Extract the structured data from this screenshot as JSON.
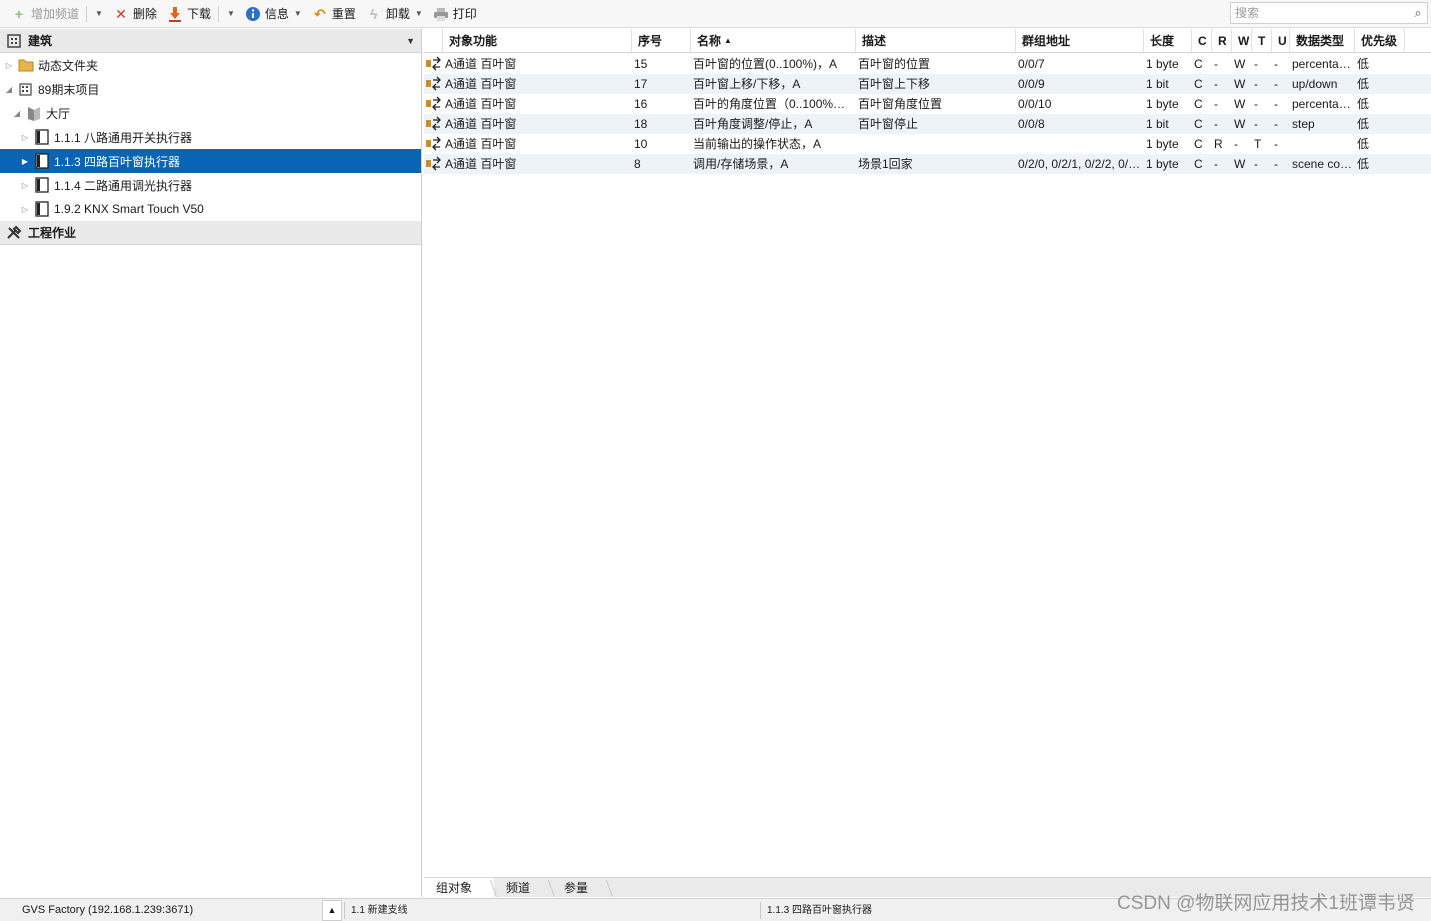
{
  "toolbar": {
    "add_channel": "增加频道",
    "delete": "删除",
    "download": "下载",
    "info": "信息",
    "reset": "重置",
    "unload": "卸载",
    "print": "打印",
    "search_placeholder": "搜索"
  },
  "left_panel": {
    "header": "建筑",
    "tree": [
      {
        "label": "动态文件夹",
        "icon": "folder-icon"
      },
      {
        "label": "89期末项目",
        "icon": "building-icon"
      },
      {
        "label": "大厅",
        "icon": "room-icon"
      },
      {
        "label": "1.1.1 八路通用开关执行器",
        "icon": "device-icon"
      },
      {
        "label": "1.1.3 四路百叶窗执行器",
        "icon": "device-icon",
        "selected": true
      },
      {
        "label": "1.1.4 二路通用调光执行器",
        "icon": "device-icon"
      },
      {
        "label": "1.9.2 KNX Smart Touch V50",
        "icon": "device-icon"
      }
    ],
    "work_header": "工程作业"
  },
  "grid": {
    "columns": [
      "对象功能",
      "序号",
      "名称",
      "描述",
      "群组地址",
      "长度",
      "C",
      "R",
      "W",
      "T",
      "U",
      "数据类型",
      "优先级"
    ],
    "rows": [
      [
        "A通道 百叶窗",
        "15",
        "百叶窗的位置(0..100%)，A",
        "百叶窗的位置",
        "0/0/7",
        "1 byte",
        "C",
        "-",
        "W",
        "-",
        "-",
        "percentag...",
        "低"
      ],
      [
        "A通道 百叶窗",
        "17",
        "百叶窗上移/下移，A",
        "百叶窗上下移",
        "0/0/9",
        "1 bit",
        "C",
        "-",
        "W",
        "-",
        "-",
        "up/down",
        "低"
      ],
      [
        "A通道 百叶窗",
        "16",
        "百叶的角度位置（0..100%）...",
        "百叶窗角度位置",
        "0/0/10",
        "1 byte",
        "C",
        "-",
        "W",
        "-",
        "-",
        "percentag...",
        "低"
      ],
      [
        "A通道 百叶窗",
        "18",
        "百叶角度调整/停止，A",
        "百叶窗停止",
        "0/0/8",
        "1 bit",
        "C",
        "-",
        "W",
        "-",
        "-",
        "step",
        "低"
      ],
      [
        "A通道 百叶窗",
        "10",
        "当前输出的操作状态，A",
        "",
        "",
        "1 byte",
        "C",
        "R",
        "-",
        "T",
        "-",
        "",
        "低"
      ],
      [
        "A通道 百叶窗",
        "8",
        "调用/存储场景，A",
        "场景1回家",
        "0/2/0, 0/2/1, 0/2/2, 0/2/3...",
        "1 byte",
        "C",
        "-",
        "W",
        "-",
        "-",
        "scene cont...",
        "低"
      ]
    ]
  },
  "tabs": [
    "组对象",
    "频道",
    "参量"
  ],
  "status": {
    "connection": "GVS Factory (192.168.1.239:3671)",
    "line": "1.1 新建支线",
    "device": "1.1.3 四路百叶窗执行器"
  },
  "watermark": "CSDN @物联网应用技术1班谭韦贤",
  "colors": {
    "selection": "#0a64b4",
    "alt_row": "#eef3fa",
    "delete_red": "#d9332b",
    "download_orange": "#e0661b",
    "info_blue": "#2a6fc9"
  }
}
